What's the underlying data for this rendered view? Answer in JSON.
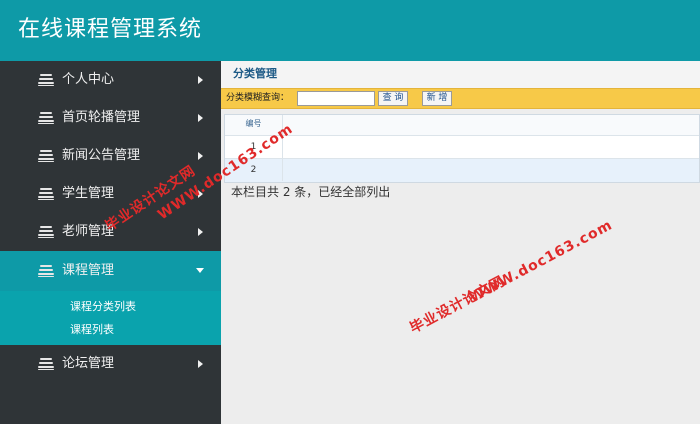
{
  "header": {
    "title": "在线课程管理系统"
  },
  "sidebar": {
    "items": [
      {
        "label": "个人中心"
      },
      {
        "label": "首页轮播管理"
      },
      {
        "label": "新闻公告管理"
      },
      {
        "label": "学生管理"
      },
      {
        "label": "老师管理"
      },
      {
        "label": "课程管理"
      },
      {
        "label": "论坛管理"
      }
    ],
    "active_item": "课程管理",
    "submenu": [
      {
        "label": "课程分类列表"
      },
      {
        "label": "课程列表"
      }
    ]
  },
  "main": {
    "page_title": "分类管理",
    "toolbar": {
      "search_label": "分类模糊查询：",
      "search_value": "",
      "query_button": "查 询",
      "new_button": "新 增"
    },
    "table": {
      "header": "编号",
      "rows": [
        "1",
        "2"
      ]
    },
    "summary": "本栏目共 2 条，已经全部列出"
  },
  "watermark": {
    "site": "WWW.doc163.com",
    "name": "毕业设计论文网"
  },
  "colors": {
    "header_bg": "#0e9aa7",
    "sidebar_bg": "#2f3437",
    "active_bg": "#0e9aa7",
    "toolbar_bg": "#f7c948",
    "watermark": "#e02a2a"
  },
  "icons": {
    "menu": "stack-icon",
    "expand": "chevron-right-icon",
    "collapse": "chevron-down-icon"
  }
}
